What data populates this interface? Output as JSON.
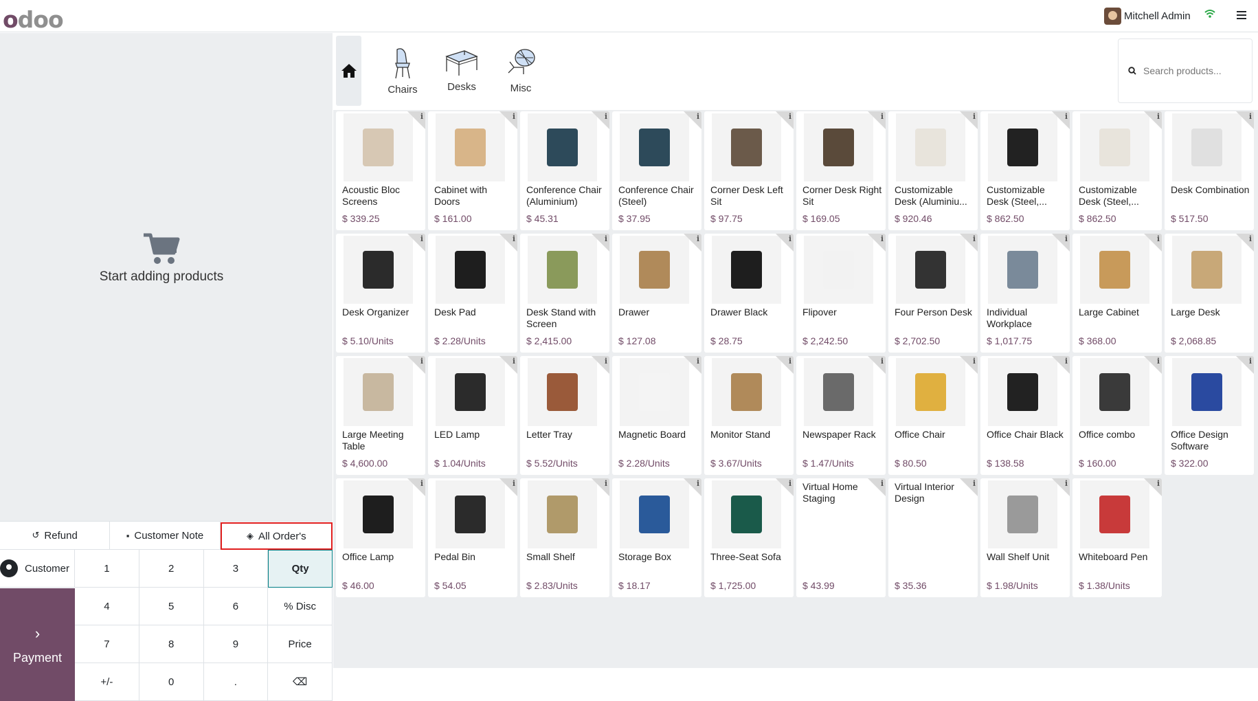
{
  "navbar": {
    "user_name": "Mitchell Admin"
  },
  "left": {
    "empty_text": "Start adding products",
    "controls": [
      {
        "label": "Refund",
        "icon": "undo-icon"
      },
      {
        "label": "Customer Note",
        "icon": "note-icon"
      },
      {
        "label": "All Order's",
        "icon": "tag-icon"
      }
    ],
    "customer_label": "Customer",
    "payment_label": "Payment",
    "numpad": [
      "1",
      "2",
      "3",
      "Qty",
      "4",
      "5",
      "6",
      "% Disc",
      "7",
      "8",
      "9",
      "Price",
      "+/-",
      "0",
      ".",
      "⌫"
    ]
  },
  "categories": [
    {
      "label": "Chairs"
    },
    {
      "label": "Desks"
    },
    {
      "label": "Misc"
    }
  ],
  "search": {
    "placeholder": "Search products..."
  },
  "products": [
    {
      "name": "Acoustic Bloc Screens",
      "price": "$ 339.25",
      "color": "#d7c8b4"
    },
    {
      "name": "Cabinet with Doors",
      "price": "$ 161.00",
      "color": "#d8b589"
    },
    {
      "name": "Conference Chair (Aluminium)",
      "price": "$ 45.31",
      "color": "#2d4a5a"
    },
    {
      "name": "Conference Chair (Steel)",
      "price": "$ 37.95",
      "color": "#2d4a5a"
    },
    {
      "name": "Corner Desk Left Sit",
      "price": "$ 97.75",
      "color": "#6b5a4a"
    },
    {
      "name": "Corner Desk Right Sit",
      "price": "$ 169.05",
      "color": "#5a4a3a"
    },
    {
      "name": "Customizable Desk (Aluminiu...",
      "price": "$ 920.46",
      "color": "#e8e4dc"
    },
    {
      "name": "Customizable Desk (Steel,...",
      "price": "$ 862.50",
      "color": "#222222"
    },
    {
      "name": "Customizable Desk (Steel,...",
      "price": "$ 862.50",
      "color": "#e8e4dc"
    },
    {
      "name": "Desk Combination",
      "price": "$ 517.50",
      "color": "#e0e0e0"
    },
    {
      "name": "Desk Organizer",
      "price": "$ 5.10/Units",
      "color": "#2b2b2b"
    },
    {
      "name": "Desk Pad",
      "price": "$ 2.28/Units",
      "color": "#1e1e1e"
    },
    {
      "name": "Desk Stand with Screen",
      "price": "$ 2,415.00",
      "color": "#8a9a5b"
    },
    {
      "name": "Drawer",
      "price": "$ 127.08",
      "color": "#b08a5a"
    },
    {
      "name": "Drawer Black",
      "price": "$ 28.75",
      "color": "#1e1e1e"
    },
    {
      "name": "Flipover",
      "price": "$ 2,242.50",
      "color": "#f2f2f2"
    },
    {
      "name": "Four Person Desk",
      "price": "$ 2,702.50",
      "color": "#333333"
    },
    {
      "name": "Individual Workplace",
      "price": "$ 1,017.75",
      "color": "#7a8a9a"
    },
    {
      "name": "Large Cabinet",
      "price": "$ 368.00",
      "color": "#c89a5a"
    },
    {
      "name": "Large Desk",
      "price": "$ 2,068.85",
      "color": "#c8a878"
    },
    {
      "name": "Large Meeting Table",
      "price": "$ 4,600.00",
      "color": "#c8b8a0"
    },
    {
      "name": "LED Lamp",
      "price": "$ 1.04/Units",
      "color": "#2b2b2b"
    },
    {
      "name": "Letter Tray",
      "price": "$ 5.52/Units",
      "color": "#9a5a3a"
    },
    {
      "name": "Magnetic Board",
      "price": "$ 2.28/Units",
      "color": "#f4f4f4"
    },
    {
      "name": "Monitor Stand",
      "price": "$ 3.67/Units",
      "color": "#b08a5a"
    },
    {
      "name": "Newspaper Rack",
      "price": "$ 1.47/Units",
      "color": "#6a6a6a"
    },
    {
      "name": "Office Chair",
      "price": "$ 80.50",
      "color": "#e0b040"
    },
    {
      "name": "Office Chair Black",
      "price": "$ 138.58",
      "color": "#222222"
    },
    {
      "name": "Office combo",
      "price": "$ 160.00",
      "color": "#3a3a3a"
    },
    {
      "name": "Office Design Software",
      "price": "$ 322.00",
      "color": "#2a4aa0"
    },
    {
      "name": "Office Lamp",
      "price": "$ 46.00",
      "color": "#1e1e1e"
    },
    {
      "name": "Pedal Bin",
      "price": "$ 54.05",
      "color": "#2b2b2b"
    },
    {
      "name": "Small Shelf",
      "price": "$ 2.83/Units",
      "color": "#b09a6a"
    },
    {
      "name": "Storage Box",
      "price": "$ 18.17",
      "color": "#2a5a9a"
    },
    {
      "name": "Three-Seat Sofa",
      "price": "$ 1,725.00",
      "color": "#1a5a4a"
    },
    {
      "name": "Virtual Home Staging",
      "price": "$ 43.99",
      "color": ""
    },
    {
      "name": "Virtual Interior Design",
      "price": "$ 35.36",
      "color": ""
    },
    {
      "name": "Wall Shelf Unit",
      "price": "$ 1.98/Units",
      "color": "#9a9a9a"
    },
    {
      "name": "Whiteboard Pen",
      "price": "$ 1.38/Units",
      "color": "#c83a3a"
    }
  ]
}
